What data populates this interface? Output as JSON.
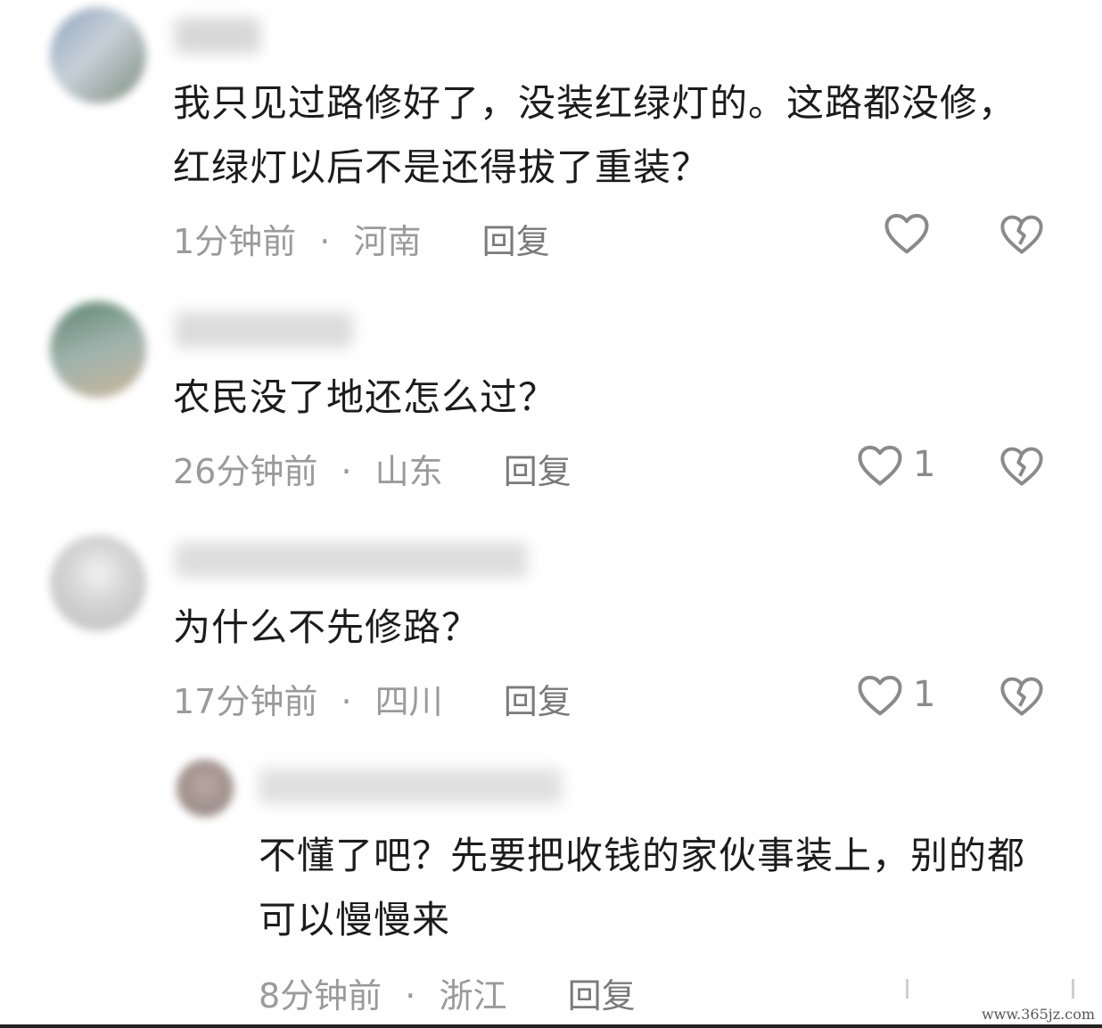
{
  "comments": [
    {
      "text": "我只见过路修好了，没装红绿灯的。这路都没修，红绿灯以后不是还得拔了重装？",
      "time": "1分钟前",
      "location": "河南",
      "reply_label": "回复",
      "like_count": "",
      "avatar_color": "#a9b6c4"
    },
    {
      "text": "农民没了地还怎么过？",
      "time": "26分钟前",
      "location": "山东",
      "reply_label": "回复",
      "like_count": "1",
      "avatar_color": "#6d8a7c"
    },
    {
      "text": "为什么不先修路？",
      "time": "17分钟前",
      "location": "四川",
      "reply_label": "回复",
      "like_count": "1",
      "avatar_color": "#d6d6d6"
    },
    {
      "text": "不懂了吧？先要把收钱的家伙事装上，别的都可以慢慢来",
      "time": "8分钟前",
      "location": "浙江",
      "reply_label": "回复",
      "like_count": "",
      "avatar_color": "#a89a96"
    }
  ],
  "separator": "·",
  "watermark": "www.365jz.com",
  "icons": {
    "like": "heart-outline-icon",
    "dislike": "broken-heart-icon"
  },
  "colors": {
    "text": "#1c1c1c",
    "meta": "#9a9a9a",
    "icon": "#8a8a8a"
  }
}
